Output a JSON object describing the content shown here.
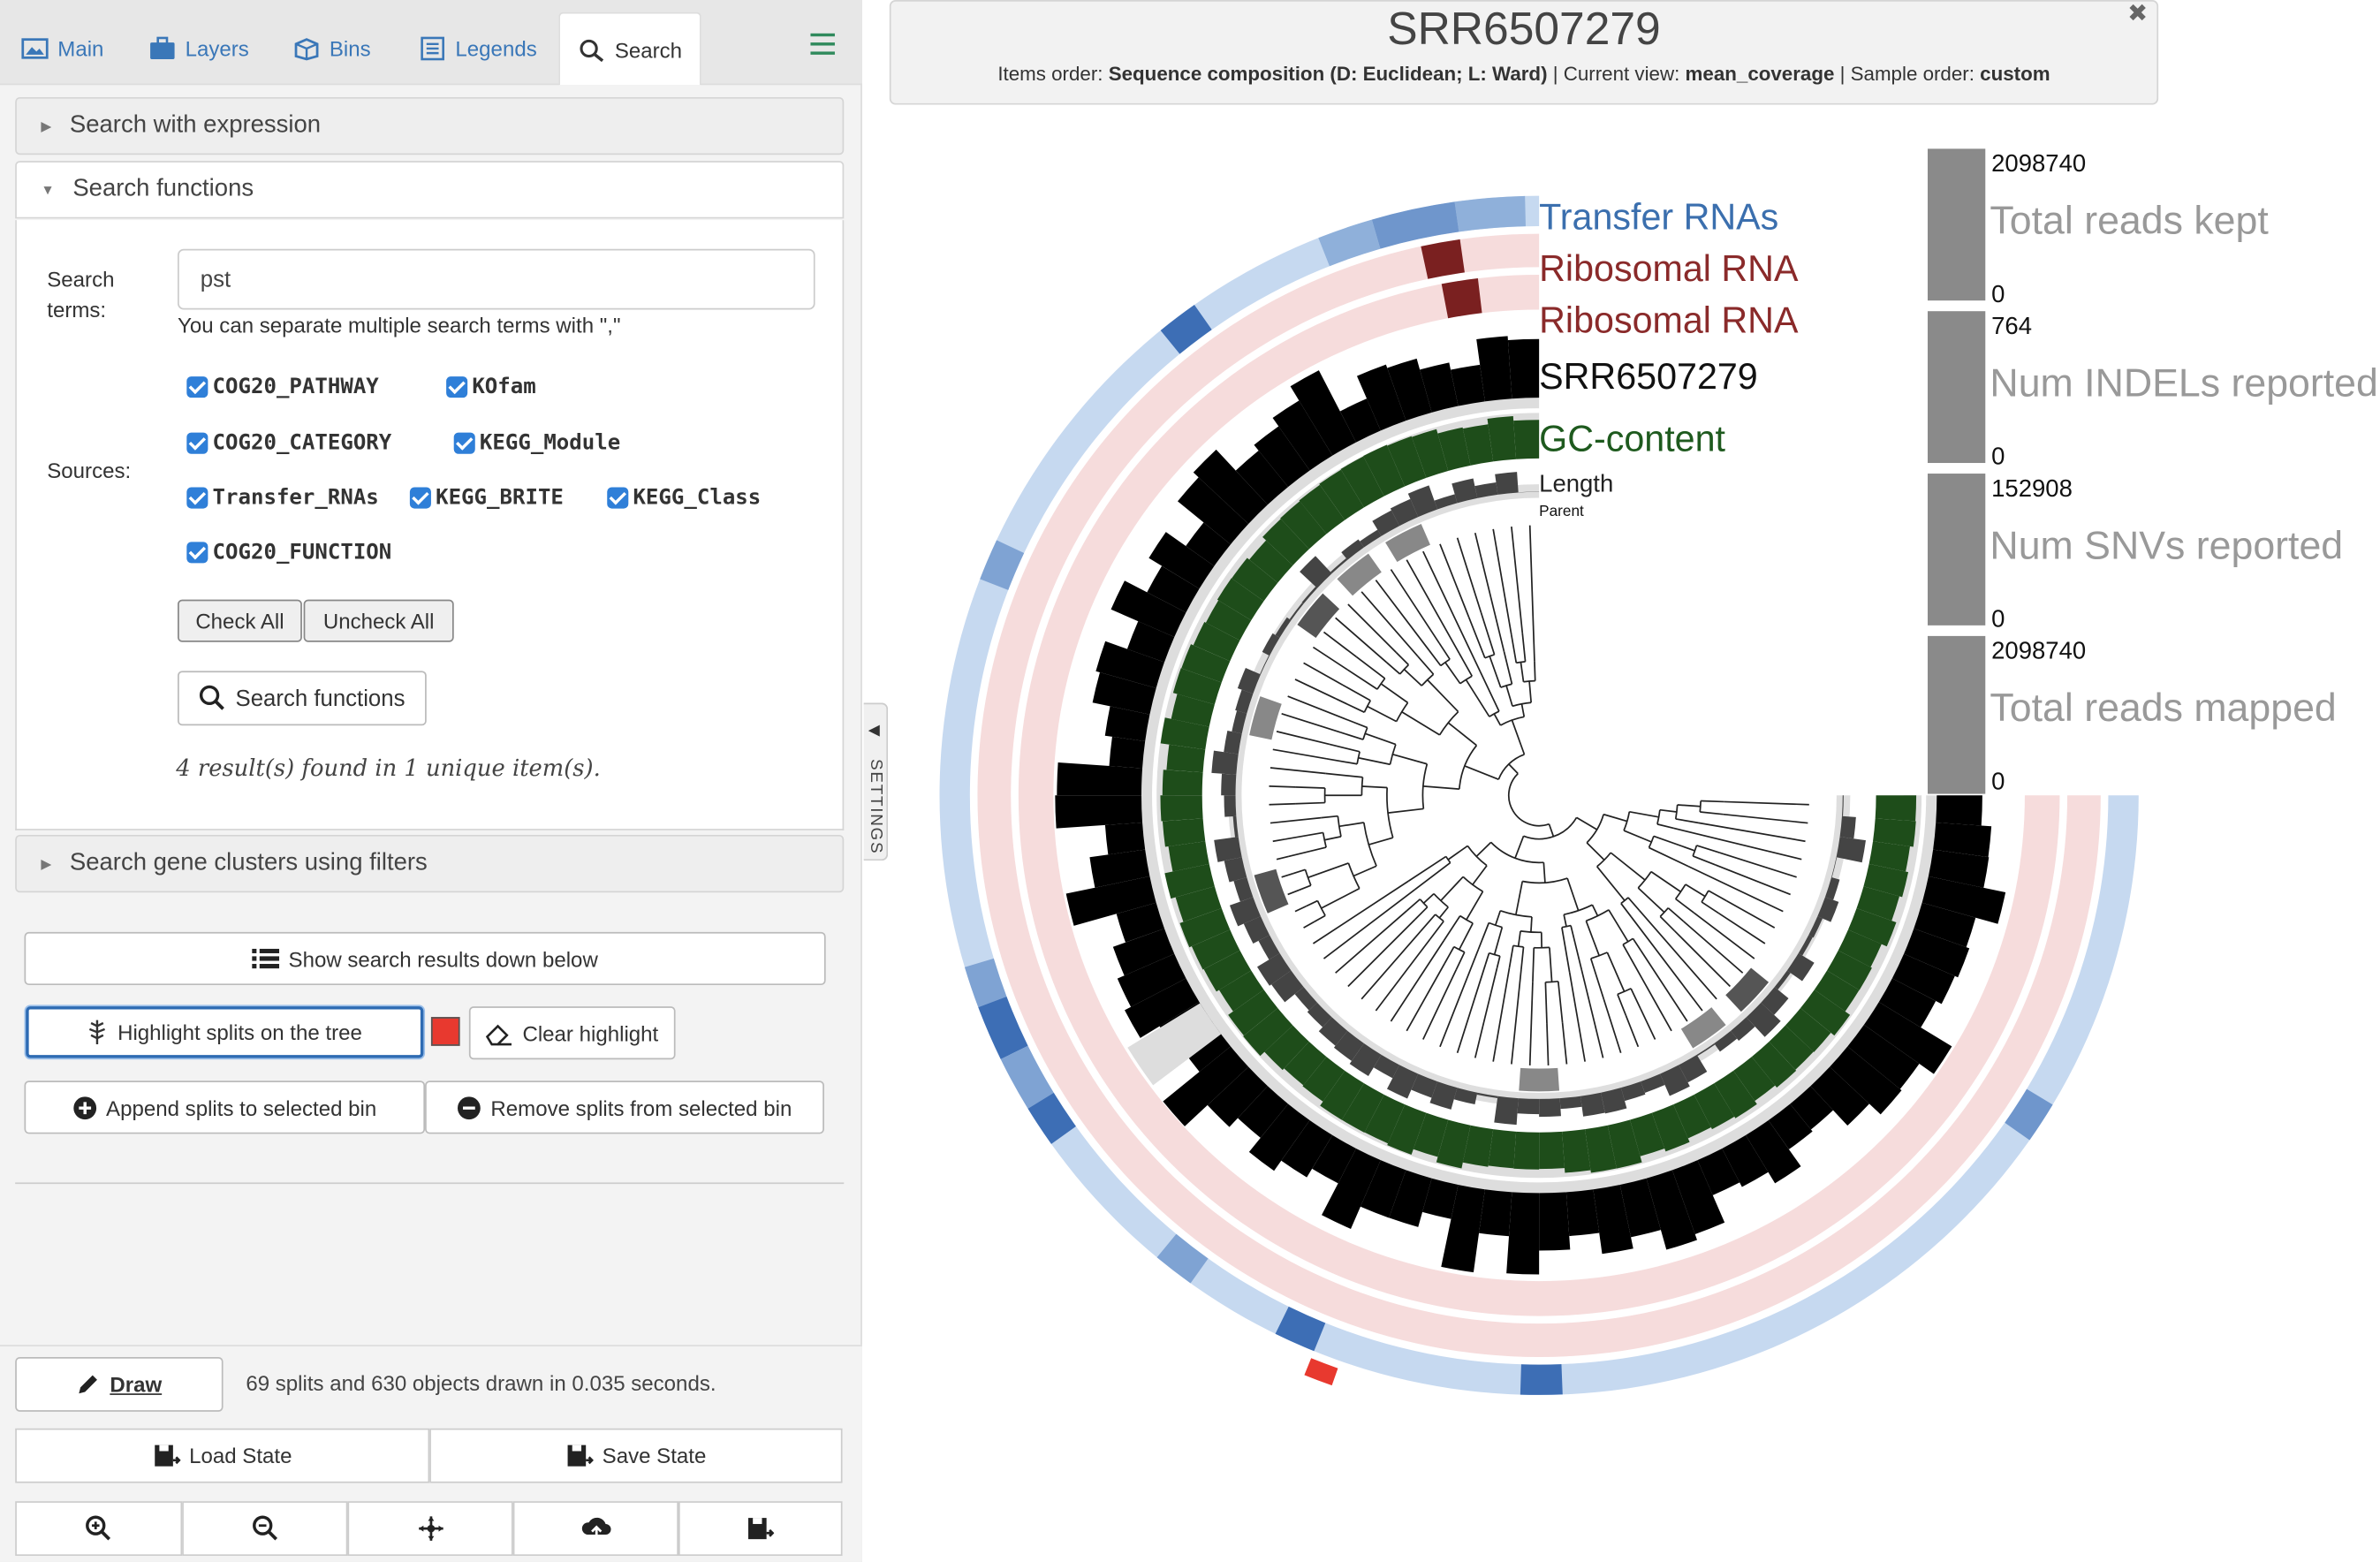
{
  "tabs": [
    {
      "label": "Main",
      "icon": "image-icon"
    },
    {
      "label": "Layers",
      "icon": "briefcase-icon"
    },
    {
      "label": "Bins",
      "icon": "box-icon"
    },
    {
      "label": "Legends",
      "icon": "list-icon"
    },
    {
      "label": "Search",
      "icon": "search-icon"
    }
  ],
  "panels": {
    "expression": "Search with expression",
    "functions": "Search functions",
    "gene_clusters": "Search gene clusters using filters"
  },
  "search": {
    "terms_label": "Search terms:",
    "value": "pst",
    "hint": "You can separate multiple search terms with \",\"",
    "sources_label": "Sources:",
    "sources": [
      "COG20_PATHWAY",
      "KOfam",
      "COG20_CATEGORY",
      "KEGG_Module",
      "Transfer_RNAs",
      "KEGG_BRITE",
      "KEGG_Class",
      "COG20_FUNCTION"
    ],
    "check_all": "Check All",
    "uncheck_all": "Uncheck All",
    "search_button": "Search functions",
    "result": "4 result(s) found in 1 unique item(s)."
  },
  "actions": {
    "show_results": "Show search results down below",
    "highlight": "Highlight splits on the tree",
    "highlight_color": "#e8392f",
    "clear": "Clear highlight",
    "append": "Append splits to selected bin",
    "remove": "Remove splits from selected bin"
  },
  "bottom": {
    "draw": "Draw",
    "status": "69 splits and 630 objects drawn in 0.035 seconds.",
    "load_state": "Load State",
    "save_state": "Save State",
    "tools": [
      "zoom-in-icon",
      "zoom-out-icon",
      "center-icon",
      "upload-icon",
      "save-icon"
    ]
  },
  "header": {
    "title": "SRR6507279",
    "items_order_label": "Items order:",
    "items_order": "Sequence composition (D: Euclidean; L: Ward)",
    "current_view_label": "Current view:",
    "current_view": "mean_coverage",
    "sample_order_label": "Sample order:",
    "sample_order": "custom"
  },
  "settings_label": "SETTINGS",
  "layers": [
    {
      "label": "Transfer RNAs",
      "color": "#3b6fae"
    },
    {
      "label": "Ribosomal RNA",
      "color": "#8a2a2a"
    },
    {
      "label": "Ribosomal RNA",
      "color": "#8a2a2a"
    },
    {
      "label": "SRR6507279",
      "color": "#111111"
    },
    {
      "label": "GC-content",
      "color": "#1e5a1e"
    },
    {
      "label": "Length",
      "color": "#222222"
    },
    {
      "label": "Parent",
      "color": "#111111"
    }
  ],
  "bars": [
    {
      "max": "2098740",
      "title": "Total reads kept",
      "min": "0"
    },
    {
      "max": "764",
      "title": "Num INDELs reported",
      "min": "0"
    },
    {
      "max": "152908",
      "title": "Num SNVs reported",
      "min": "0"
    },
    {
      "max": "2098740",
      "title": "Total reads mapped",
      "min": "0"
    }
  ]
}
